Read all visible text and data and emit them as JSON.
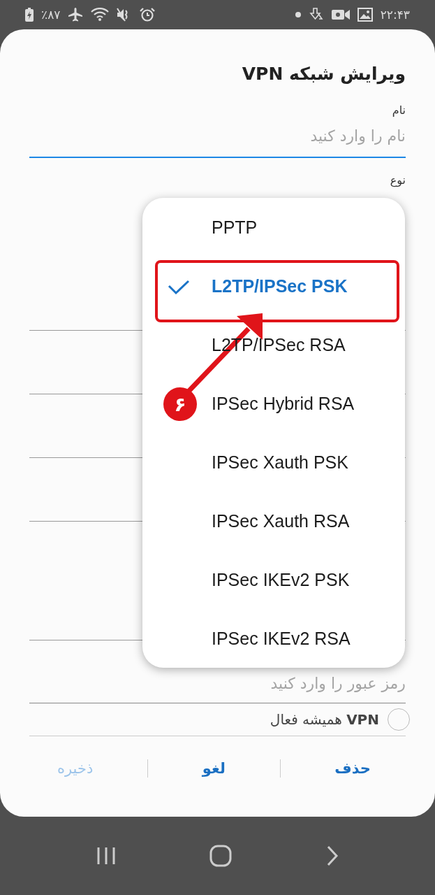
{
  "status_bar": {
    "battery": "٪۸۷",
    "time": "۲۲:۴۳"
  },
  "dialog": {
    "title": "ویرایش شبکه VPN",
    "name_field": {
      "label": "نام",
      "placeholder": "نام را وارد کنید",
      "focused": true
    },
    "type_label": "نوع",
    "password_field": {
      "placeholder": "رمز عبور را وارد کنید"
    },
    "always_on": {
      "label": "**VPN** همیشه فعال",
      "checked": false
    },
    "buttons": [
      {
        "label": "حذف",
        "disabled": false
      },
      {
        "label": "لغو",
        "disabled": false
      },
      {
        "label": "ذخیره",
        "disabled": true
      }
    ]
  },
  "type_menu": [
    {
      "label": "PPTP",
      "selected": false
    },
    {
      "label": "L2TP/IPSec PSK",
      "selected": true
    },
    {
      "label": "L2TP/IPSec RSA",
      "selected": false
    },
    {
      "label": "IPSec Hybrid RSA",
      "selected": false
    },
    {
      "label": "IPSec Xauth PSK",
      "selected": false
    },
    {
      "label": "IPSec Xauth RSA",
      "selected": false
    },
    {
      "label": "IPSec IKEv2 PSK",
      "selected": false
    },
    {
      "label": "IPSec IKEv2 RSA",
      "selected": false
    }
  ],
  "annotation": {
    "badge": "۶"
  }
}
